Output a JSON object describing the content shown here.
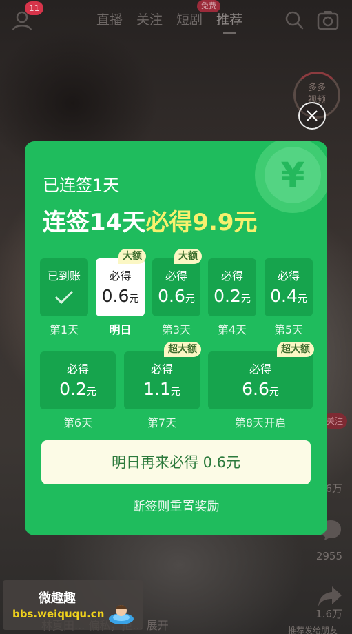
{
  "topbar": {
    "notification_count": "11",
    "tabs": [
      {
        "label": "直播"
      },
      {
        "label": "关注"
      },
      {
        "label": "短剧"
      },
      {
        "label": "推荐"
      }
    ],
    "free_badge": "免费"
  },
  "side": {
    "ring_text_1": "多多",
    "ring_text_2": "视频",
    "likes": "1.6万",
    "comments": "2955",
    "shares": "1.6万",
    "follow": "关注"
  },
  "bottom": {
    "caption": "林夏田... 偏私，拒...   展开",
    "share_label": "推荐发给朋友"
  },
  "popup": {
    "streak_text": "已连签1天",
    "headline_prefix": "连签14天",
    "headline_highlight": "必得9.9元",
    "coin_symbol": "¥",
    "days": [
      {
        "top": "已到账",
        "value": "",
        "unit": "",
        "label": "第1天",
        "badge": "",
        "status": "received"
      },
      {
        "top": "必得",
        "value": "0.6",
        "unit": "元",
        "label": "明日",
        "badge": "大额",
        "status": "tomorrow"
      },
      {
        "top": "必得",
        "value": "0.6",
        "unit": "元",
        "label": "第3天",
        "badge": "大额",
        "status": "pending"
      },
      {
        "top": "必得",
        "value": "0.2",
        "unit": "元",
        "label": "第4天",
        "badge": "",
        "status": "pending"
      },
      {
        "top": "必得",
        "value": "0.4",
        "unit": "元",
        "label": "第5天",
        "badge": "",
        "status": "pending"
      },
      {
        "top": "必得",
        "value": "0.2",
        "unit": "元",
        "label": "第6天",
        "badge": "",
        "status": "pending"
      },
      {
        "top": "必得",
        "value": "1.1",
        "unit": "元",
        "label": "第7天",
        "badge": "超大额",
        "status": "pending"
      },
      {
        "top": "必得",
        "value": "6.6",
        "unit": "元",
        "label": "第8天开启",
        "badge": "超大额",
        "status": "pending"
      }
    ],
    "cta_label": "明日再来必得 0.6元",
    "reset_note": "断签则重置奖励"
  },
  "watermark": {
    "title": "微趣趣",
    "url": "bbs.weiququ.cn"
  },
  "colors": {
    "popup_green": "#1fbc5d",
    "tile_green": "#16a44d",
    "highlight_yellow": "#f7f06d",
    "cta_bg": "#fcfbe6",
    "badge_bg": "#fbf7c4"
  }
}
